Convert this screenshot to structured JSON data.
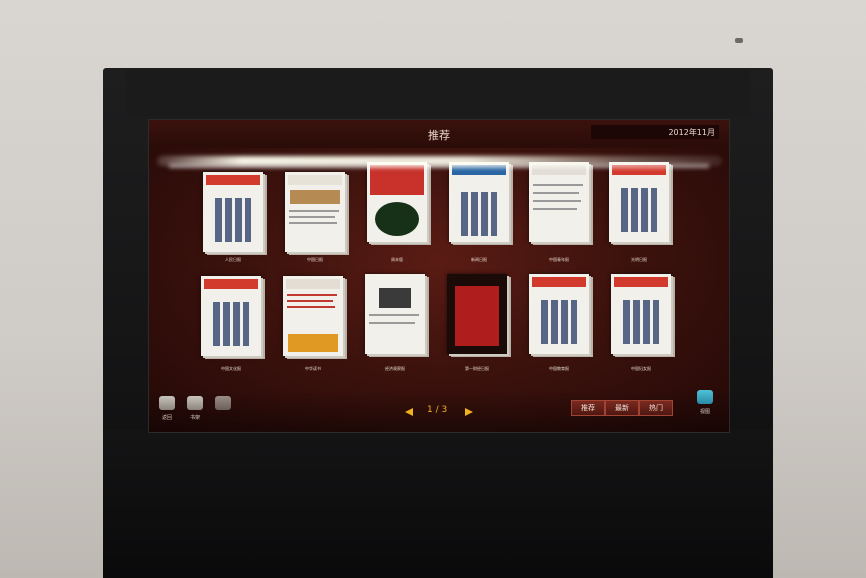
{
  "screen": {
    "title": "推荐",
    "date": "2012年11月",
    "pager": "1 / 3",
    "tabs": [
      {
        "label": "推荐",
        "active": true
      },
      {
        "label": "最新",
        "active": false
      },
      {
        "label": "热门",
        "active": false
      }
    ],
    "left_buttons": [
      {
        "icon": "back-icon",
        "label": "返回"
      },
      {
        "icon": "bookshelf-icon",
        "label": "书架"
      },
      {
        "icon": "blank-icon",
        "label": ""
      }
    ],
    "view_button": {
      "icon": "view-icon",
      "label": "视图"
    },
    "row1_captions": [
      "人民日报",
      "中国日报",
      "周末版",
      "新闻日报",
      "中国青年报",
      "光明日报"
    ],
    "row2_captions": [
      "中国文化报",
      "中华读书",
      "经济观察报",
      "第一财经日报",
      "中国教育报",
      "中国妇女报"
    ]
  },
  "colors": {
    "screen_bg": "#3d120d",
    "accent": "#f0b21e",
    "tab": "#7b2a20"
  }
}
